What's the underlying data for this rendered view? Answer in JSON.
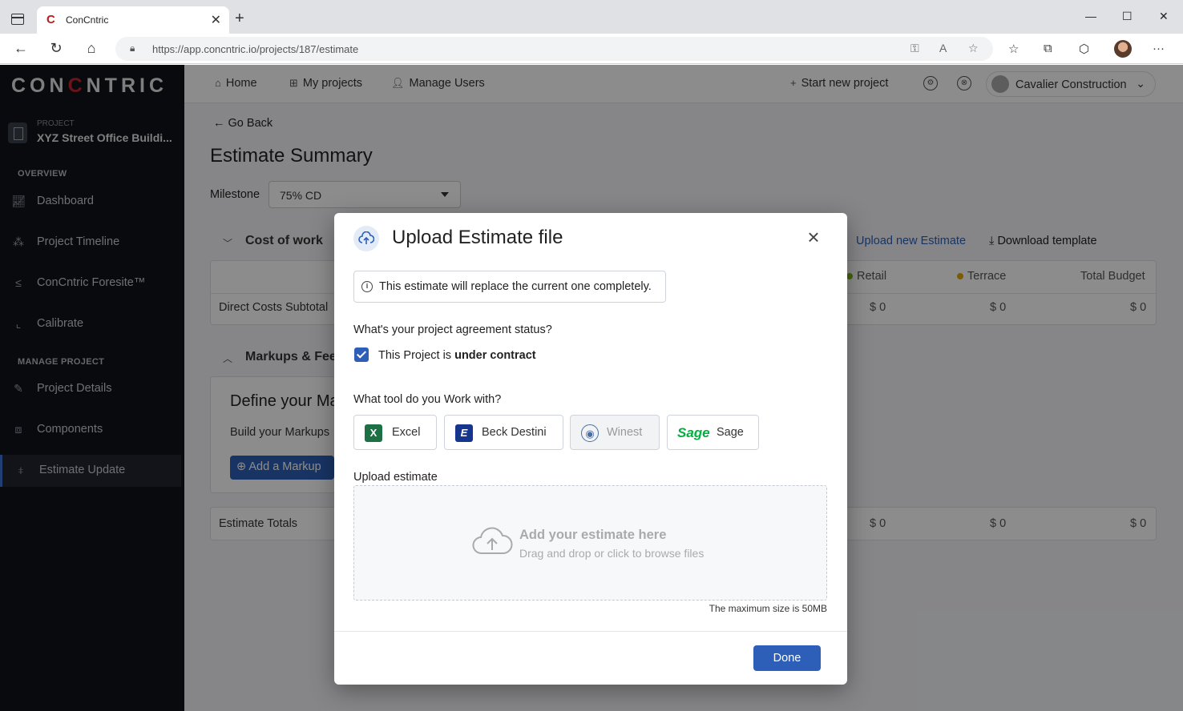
{
  "browser": {
    "tab_title": "ConCntric",
    "url_host": "https://app.concntric.io",
    "url_path": "/projects/187/estimate"
  },
  "sidebar": {
    "logo_left": "CON",
    "logo_c": "C",
    "logo_right": "NTRIC",
    "project_label": "PROJECT",
    "project_name": "XYZ Street Office Buildi...",
    "overview_title": "OVERVIEW",
    "manage_title": "MANAGE PROJECT",
    "items": [
      {
        "label": "Dashboard",
        "icon": "chart-line-icon"
      },
      {
        "label": "Project Timeline",
        "icon": "timeline-icon"
      },
      {
        "label": "ConCntric Foresite™",
        "icon": "foresite-icon"
      },
      {
        "label": "Calibrate",
        "icon": "calibrate-icon"
      },
      {
        "label": "Project Details",
        "icon": "edit-icon"
      },
      {
        "label": "Components",
        "icon": "components-icon"
      },
      {
        "label": "Estimate Update",
        "icon": "sliders-icon"
      }
    ]
  },
  "topnav": {
    "home": "Home",
    "my_projects": "My projects",
    "manage_users": "Manage Users",
    "start_new": "Start new project",
    "company": "Cavalier Construction"
  },
  "page": {
    "go_back": "Go Back",
    "title": "Estimate Summary",
    "milestone_label": "Milestone",
    "milestone_value": "75% CD",
    "cost_of_work": "Cost of work",
    "upload_new": "Upload new Estimate",
    "download_template": "Download template",
    "col_retail": "Retail",
    "col_terrace": "Terrace",
    "col_total": "Total Budget",
    "direct_costs": "Direct Costs Subtotal",
    "zero": "$ 0",
    "markups_fees": "Markups & Fees",
    "define_markups": "Define your Markups",
    "build_markups": "Build your Markups",
    "add_markup": "Add a Markup",
    "estimate_totals": "Estimate Totals",
    "colors": {
      "retail": "#7cb518",
      "terrace": "#e0a800"
    }
  },
  "modal": {
    "title": "Upload Estimate file",
    "info": "This estimate will replace the current one completely.",
    "q_agreement": "What's your project agreement status?",
    "checkbox_prefix": "This Project is ",
    "checkbox_bold": "under contract",
    "q_tool": "What tool do you Work with?",
    "tools": [
      {
        "label": "Excel"
      },
      {
        "label": "Beck Destini"
      },
      {
        "label": "Winest"
      },
      {
        "label": "Sage",
        "logo_text": "Sage"
      }
    ],
    "upload_label": "Upload estimate",
    "drop_title": "Add your estimate here",
    "drop_sub": "Drag and drop or click to browse files",
    "max_size": "The maximum size is 50MB",
    "done": "Done"
  }
}
